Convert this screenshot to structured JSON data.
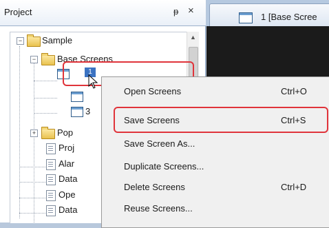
{
  "project_pane": {
    "title": "Project",
    "pin_glyph": "ᵽ",
    "close_glyph": "×"
  },
  "tree": {
    "root_label": "Sample",
    "base_screens_label": "Base Screens",
    "selected_screen_label": "1",
    "child_partial_2": "",
    "child_partial_3": "3",
    "popup_label": "Pop",
    "items": [
      {
        "label": "Proj"
      },
      {
        "label": "Alar"
      },
      {
        "label": "Data"
      },
      {
        "label": "Ope"
      },
      {
        "label": "Data"
      }
    ]
  },
  "doc_tab": {
    "label": "1  [Base Scree"
  },
  "context_menu": {
    "items": [
      {
        "label": "Open Screens",
        "shortcut": "Ctrl+O"
      },
      {
        "label": "Save Screens",
        "shortcut": "Ctrl+S"
      },
      {
        "label": "Save Screen As...",
        "shortcut": ""
      },
      {
        "label": "Duplicate Screens...",
        "shortcut": ""
      },
      {
        "label": "Delete Screens",
        "shortcut": "Ctrl+D"
      },
      {
        "label": "Reuse Screens...",
        "shortcut": ""
      }
    ]
  },
  "colors": {
    "highlight_border": "#e0333a",
    "selection": "#3b73c2"
  }
}
